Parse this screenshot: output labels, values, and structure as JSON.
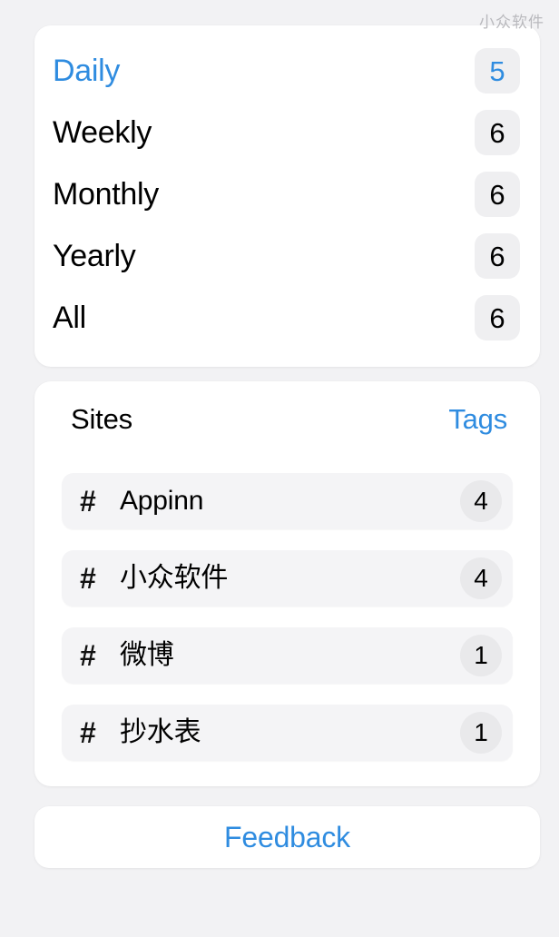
{
  "watermark": "小众软件",
  "period_card": {
    "rows": [
      {
        "label": "Daily",
        "count": "5",
        "selected": true
      },
      {
        "label": "Weekly",
        "count": "6",
        "selected": false
      },
      {
        "label": "Monthly",
        "count": "6",
        "selected": false
      },
      {
        "label": "Yearly",
        "count": "6",
        "selected": false
      },
      {
        "label": "All",
        "count": "6",
        "selected": false
      }
    ]
  },
  "tags_card": {
    "segments": [
      {
        "label": "Sites",
        "active": true
      },
      {
        "label": "Tags",
        "active": false
      }
    ],
    "tags": [
      {
        "icon": "hash-icon",
        "glyph": "#",
        "name": "Appinn",
        "count": "4"
      },
      {
        "icon": "hash-icon",
        "glyph": "#",
        "name": "小众软件",
        "count": "4"
      },
      {
        "icon": "hash-icon",
        "glyph": "#",
        "name": "微博",
        "count": "1"
      },
      {
        "icon": "hash-icon",
        "glyph": "#",
        "name": "抄水表",
        "count": "1"
      }
    ]
  },
  "feedback": {
    "label": "Feedback"
  },
  "colors": {
    "accent": "#2f8ce0",
    "page_background": "#f2f2f4",
    "card_background": "#ffffff",
    "badge_background": "#efeff1",
    "tag_row_background": "#f4f4f6",
    "text_primary": "#000000",
    "watermark": "#b9b9bd"
  }
}
